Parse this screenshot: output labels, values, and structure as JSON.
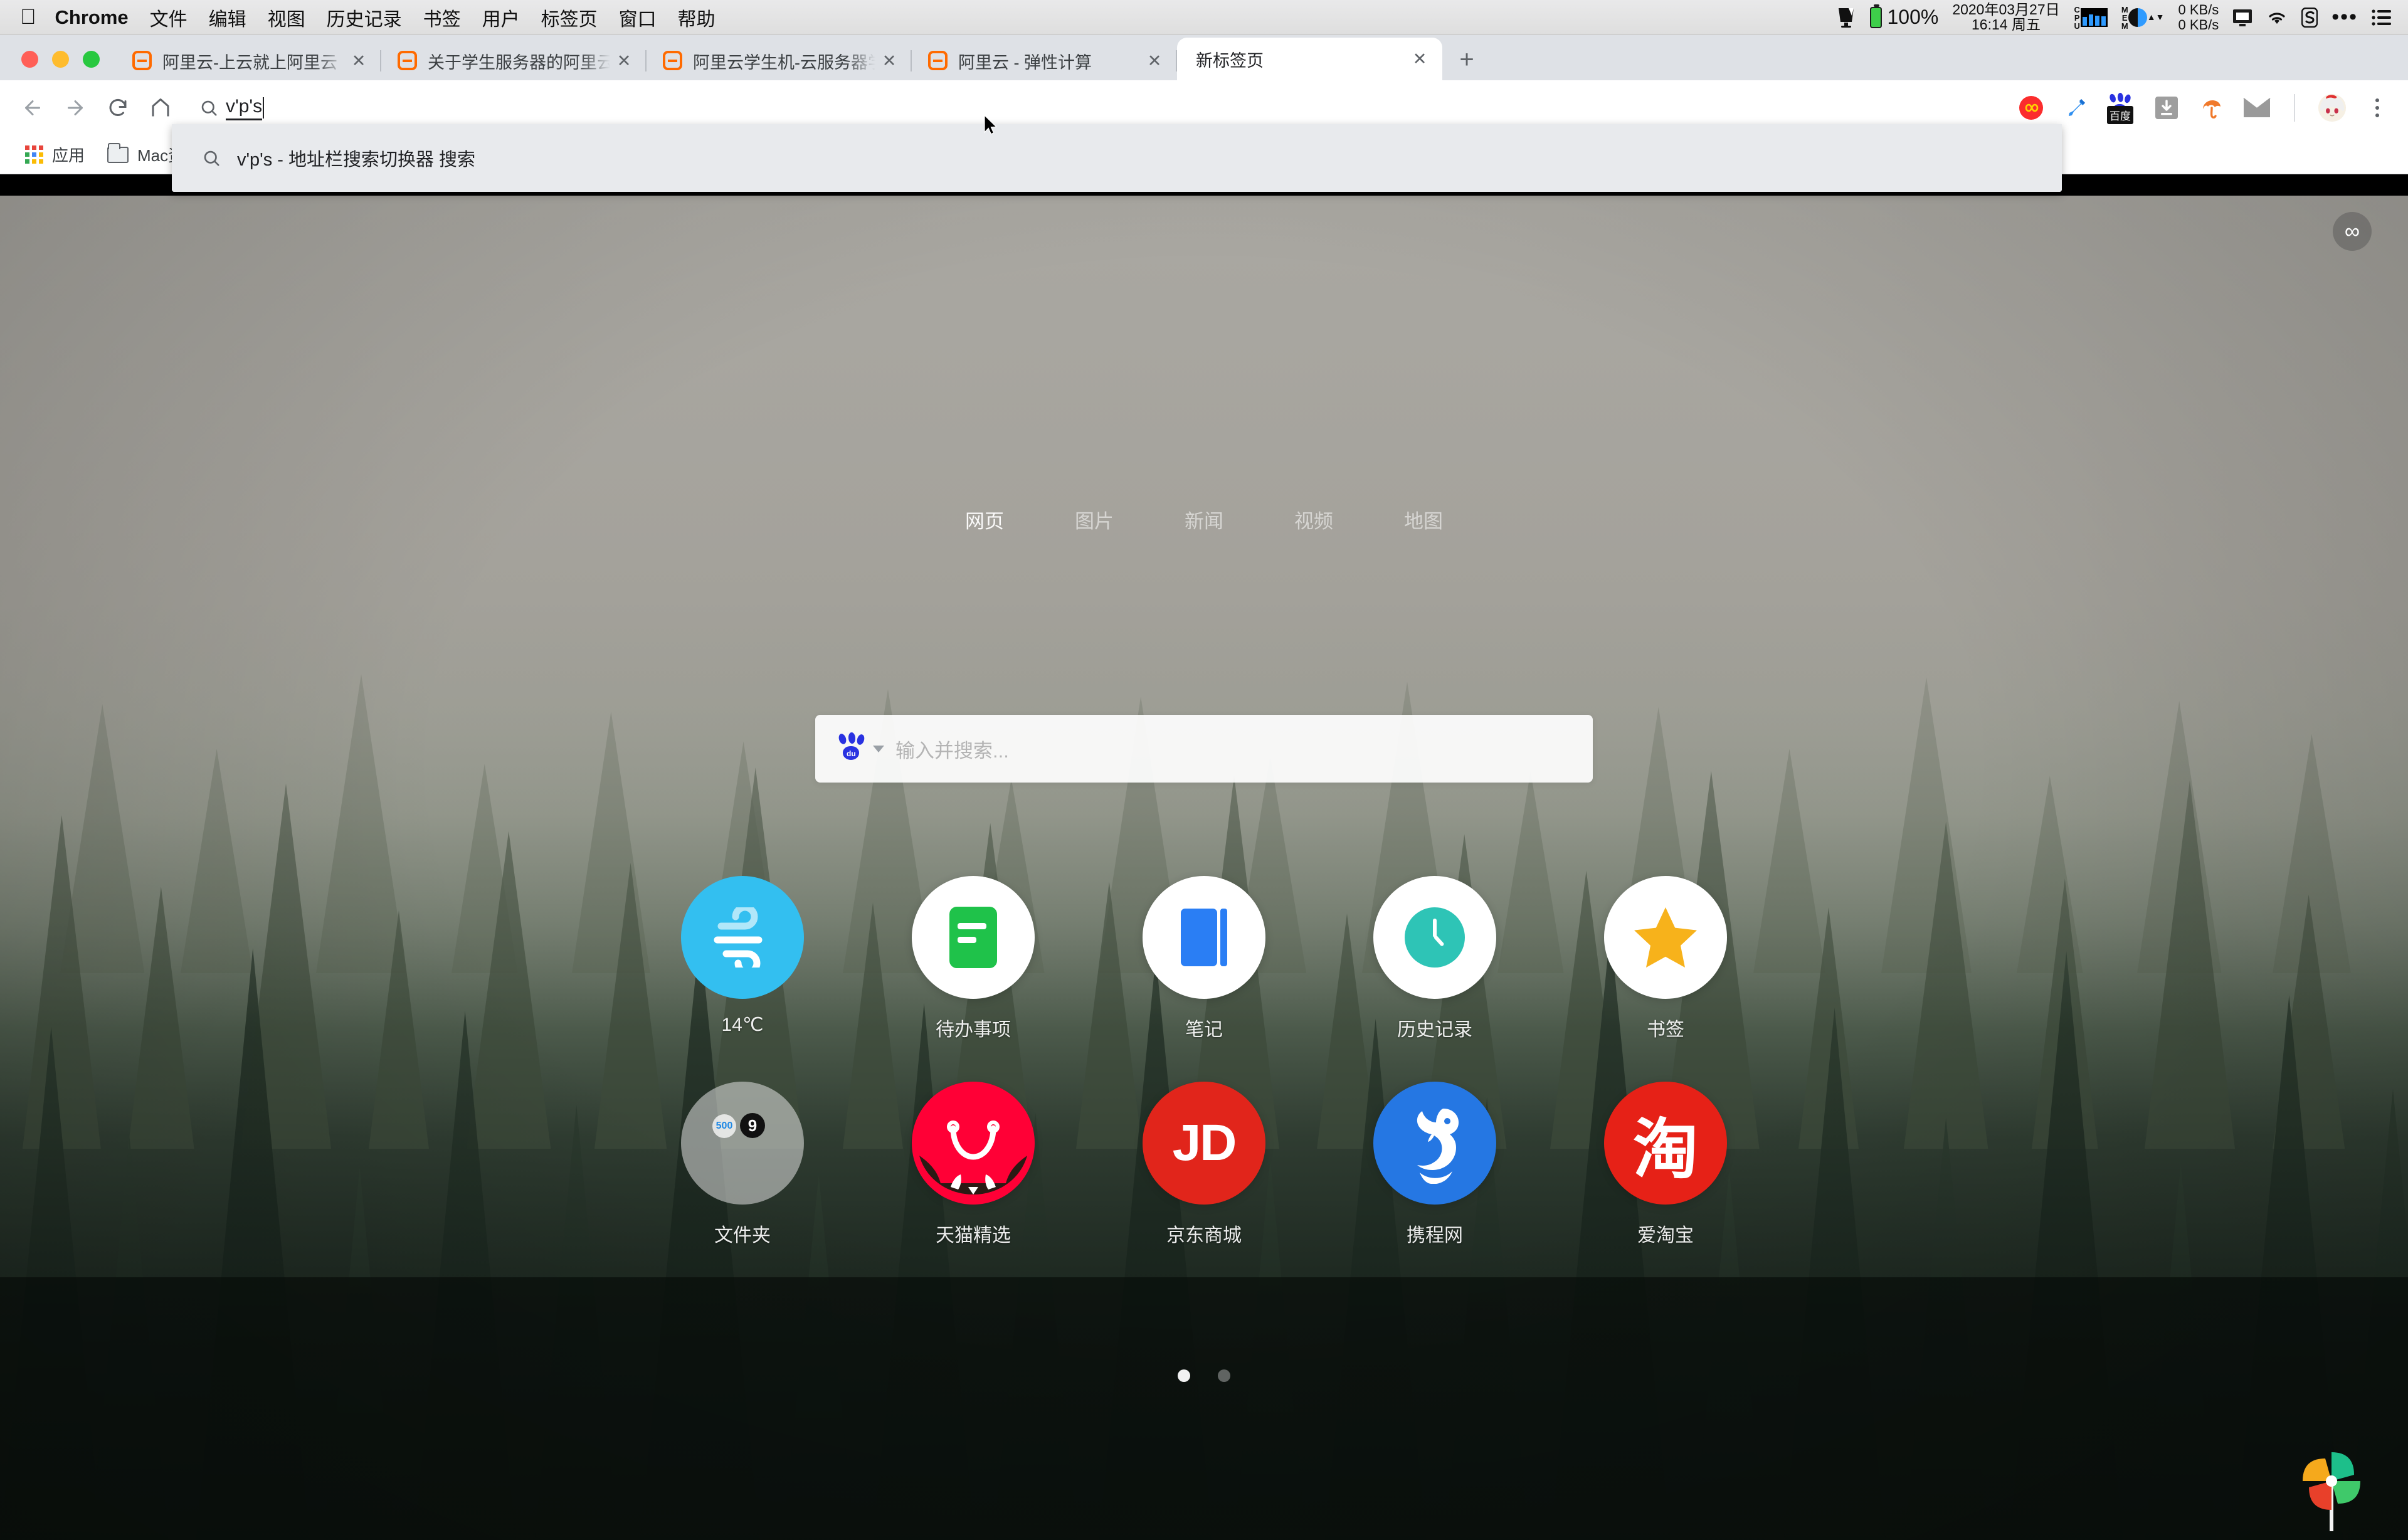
{
  "menubar": {
    "apple": "",
    "app": "Chrome",
    "items": [
      "文件",
      "编辑",
      "视图",
      "历史记录",
      "书签",
      "用户",
      "标签页",
      "窗口",
      "帮助"
    ],
    "status": {
      "battery_percent": "100%",
      "date": "2020年03月27日",
      "time": "16:14 周五",
      "cpu_label": "CPU",
      "mem_label": "MEM",
      "net_up": "0 KB/s",
      "net_down": "0 KB/s",
      "icons": [
        "screen-mirror-icon",
        "battery-icon",
        "cpu-monitor-icon",
        "mem-monitor-icon",
        "network-speed-icon",
        "display-icon",
        "wifi-icon",
        "sogou-input-icon",
        "more-icon",
        "control-center-icon"
      ]
    }
  },
  "tabs": [
    {
      "title": "阿里云-上云就上阿里云",
      "active": false
    },
    {
      "title": "关于学生服务器的阿里云网站内",
      "active": false
    },
    {
      "title": "阿里云学生机-云服务器学生机价",
      "active": false
    },
    {
      "title": "阿里云 - 弹性计算",
      "active": false
    },
    {
      "title": "新标签页",
      "active": true
    }
  ],
  "tab_close_label": "✕",
  "newtab_label": "+",
  "toolbar": {
    "back": "back-arrow",
    "forward": "forward-arrow",
    "reload": "reload-arrow",
    "home": "home-icon",
    "omnibox_value": "v'p's",
    "extensions": [
      "infinity-ext-icon",
      "eyedropper-ext-icon",
      "baidu-ext-icon",
      "download-ext-icon",
      "umbrella-ext-icon",
      "mail-ext-icon"
    ],
    "baidu_badge": "百度",
    "profile": "avatar",
    "menu": "three-dot-menu"
  },
  "bookmarks": [
    {
      "label": "应用",
      "icon": "apps-grid-icon"
    },
    {
      "label": "Mac资",
      "icon": "folder-icon"
    }
  ],
  "omnibox_dropdown": {
    "suggestion": "v'p's - 地址栏搜索切换器 搜索"
  },
  "newtab": {
    "infinity_badge": "∞",
    "categories": [
      {
        "label": "网页",
        "active": true
      },
      {
        "label": "图片",
        "active": false
      },
      {
        "label": "新闻",
        "active": false
      },
      {
        "label": "视频",
        "active": false
      },
      {
        "label": "地图",
        "active": false
      }
    ],
    "search": {
      "engine": "baidu",
      "placeholder": "输入并搜索..."
    },
    "shortcuts": [
      {
        "label": "14℃",
        "icon": "wind-weather-icon",
        "style": "weather"
      },
      {
        "label": "待办事项",
        "icon": "todo-list-icon",
        "style": "white"
      },
      {
        "label": "笔记",
        "icon": "notes-icon",
        "style": "white"
      },
      {
        "label": "历史记录",
        "icon": "clock-history-icon",
        "style": "white"
      },
      {
        "label": "书签",
        "icon": "star-bookmark-icon",
        "style": "white"
      },
      {
        "label": "文件夹",
        "icon": "folder-stack-icon",
        "style": "folder"
      },
      {
        "label": "天猫精选",
        "icon": "tmall-cat-icon",
        "style": "tmall"
      },
      {
        "label": "京东商城",
        "icon": "jd-logo-icon",
        "style": "jd",
        "text": "JD"
      },
      {
        "label": "携程网",
        "icon": "ctrip-dolphin-icon",
        "style": "ctrip"
      },
      {
        "label": "爱淘宝",
        "icon": "taobao-logo-icon",
        "style": "taobao",
        "text": "淘"
      }
    ],
    "page_dots": [
      true,
      false
    ],
    "pinwheel": "pinwheel-logo"
  },
  "colors": {
    "accent_orange": "#ff6a00",
    "baidu_blue": "#2932e1",
    "tmall_red": "#ff0036",
    "jd_red": "#e1251b",
    "ctrip_blue": "#2577e3",
    "taobao_red": "#e62117",
    "weather_cyan": "#33bff0",
    "todo_green": "#1fc24a",
    "notes_blue": "#2a7ef4",
    "clock_teal": "#2ec4b6",
    "star_yellow": "#f7b21b",
    "chrome_tabstrip": "#dee1e6"
  }
}
